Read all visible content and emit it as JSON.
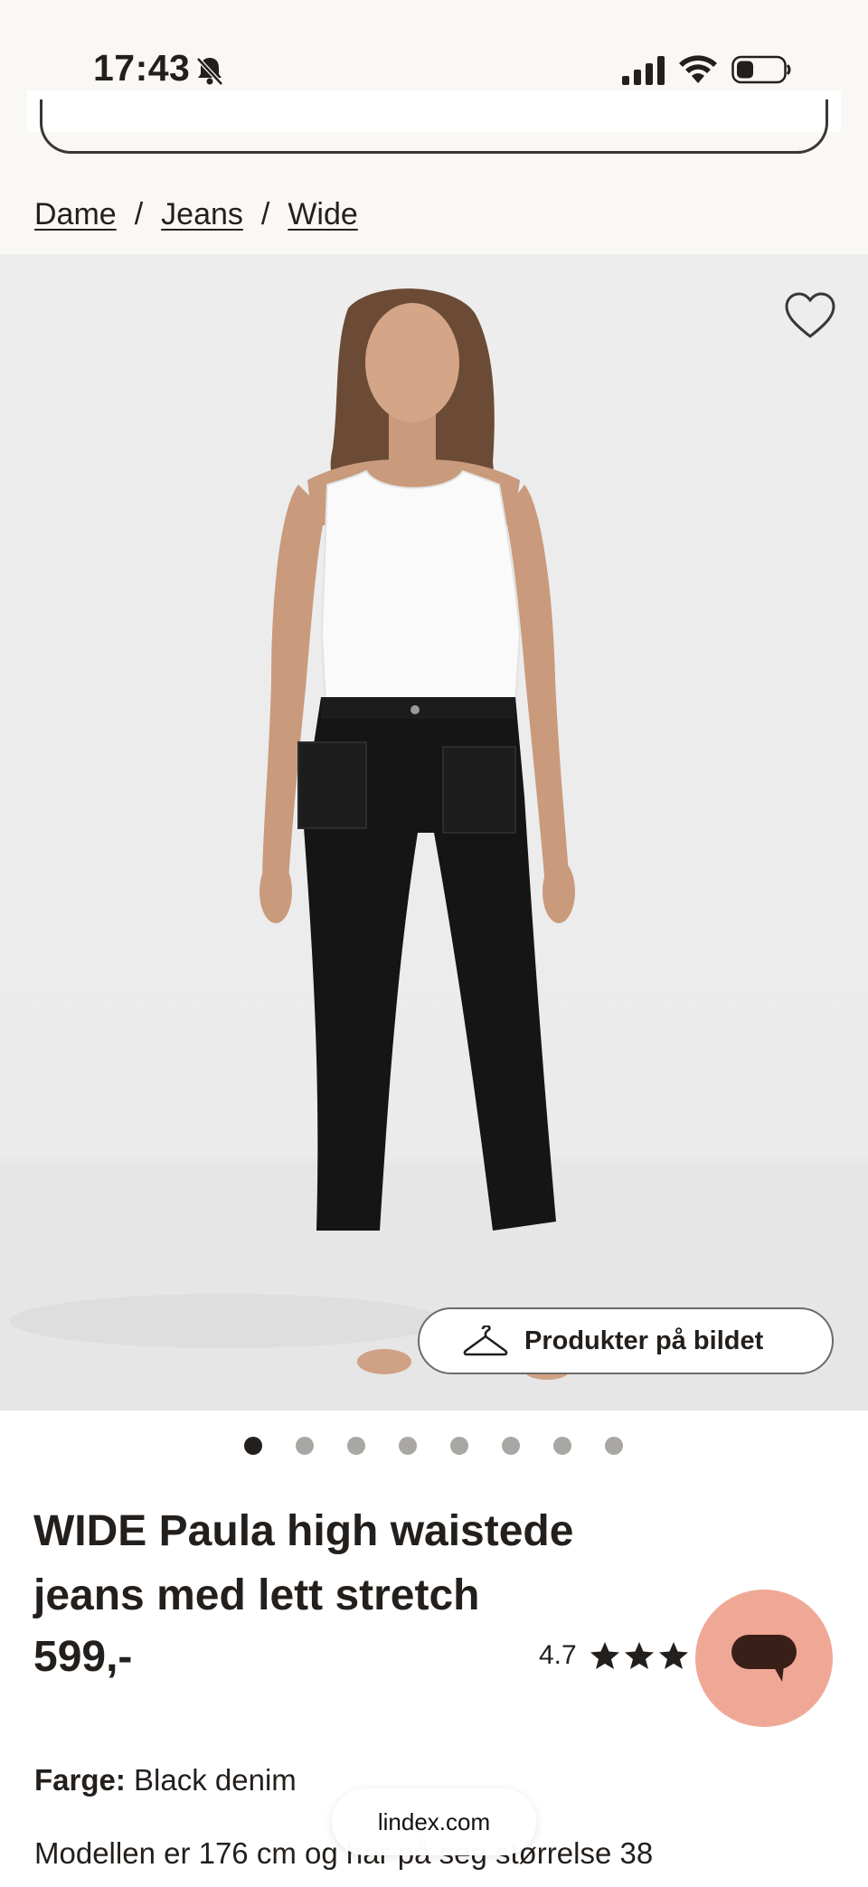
{
  "status_bar": {
    "time": "17:43",
    "icons": [
      "bell-slash-icon",
      "signal-icon",
      "wifi-icon",
      "battery-icon"
    ]
  },
  "breadcrumb": {
    "items": [
      "Dame",
      "Jeans",
      "Wide"
    ],
    "separator": "/"
  },
  "product_image": {
    "favorite_icon": "heart-outline-icon",
    "products_button_label": "Produkter på bildet",
    "products_button_icon": "hanger-icon",
    "carousel_total": 8,
    "carousel_active_index": 0
  },
  "product": {
    "title": "WIDE Paula high waistede jeans med lett stretch",
    "price": "599,-",
    "rating": "4.7",
    "stars_visible": 3,
    "color_label": "Farge:",
    "color_value": "Black denim",
    "model_info": "Modellen er 176 cm og har på seg størrelse 38"
  },
  "chat": {
    "icon": "chat-bubble-icon",
    "color": "#f0a896"
  },
  "browser": {
    "url": "lindex.com"
  },
  "colors": {
    "text": "#231f1c",
    "header_bg": "#f9f8f5",
    "image_bg": "#ededed"
  }
}
